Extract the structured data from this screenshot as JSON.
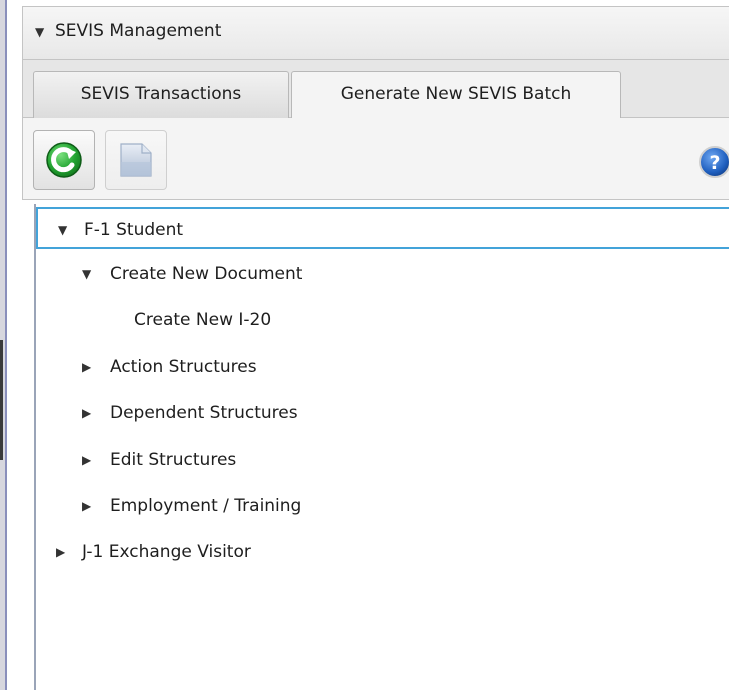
{
  "pane": {
    "title": "SEVIS Management",
    "arrow": "▼"
  },
  "tabs": [
    {
      "label": "SEVIS Transactions",
      "active": false
    },
    {
      "label": "Generate New SEVIS Batch",
      "active": true
    }
  ],
  "toolbar": {
    "refresh_icon": "refresh-icon",
    "document_icon": "document-icon",
    "help_icon": "help-icon",
    "help_glyph": "?"
  },
  "tree": {
    "items": [
      {
        "label": "F-1 Student",
        "expanded": true,
        "toggle": "▼",
        "selected": true
      },
      {
        "label": "Create New Document",
        "expanded": true,
        "toggle": "▼"
      },
      {
        "label": "Create New I-20",
        "leaf": true
      },
      {
        "label": "Action Structures",
        "expanded": false,
        "toggle": "▶"
      },
      {
        "label": "Dependent Structures",
        "expanded": false,
        "toggle": "▶"
      },
      {
        "label": "Edit Structures",
        "expanded": false,
        "toggle": "▶"
      },
      {
        "label": "Employment / Training",
        "expanded": false,
        "toggle": "▶"
      },
      {
        "label": "J-1 Exchange Visitor",
        "expanded": false,
        "toggle": "▶"
      }
    ]
  },
  "colors": {
    "selection_border": "#43a3d9",
    "refresh_green": "#1f9a2e",
    "help_blue": "#1f5fbf"
  }
}
